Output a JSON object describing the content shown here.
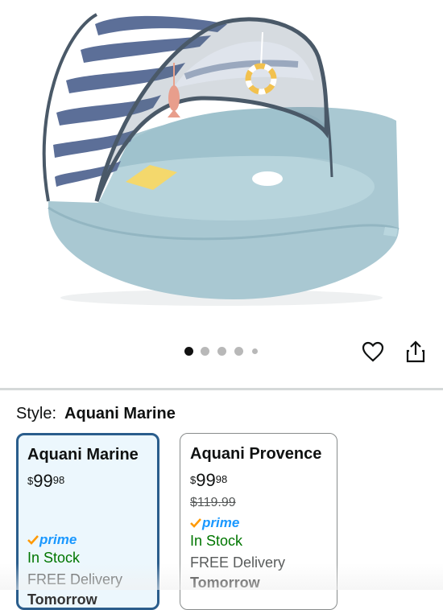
{
  "gallery": {
    "image_alt": "Pop-up baby beach tent with striped canopy",
    "dots_count": 5,
    "active_dot": 0,
    "wishlist_icon": "heart-icon",
    "share_icon": "share-icon"
  },
  "style_selector": {
    "label": "Style:",
    "selected_value": "Aquani Marine"
  },
  "options": [
    {
      "name": "Aquani Marine",
      "price_symbol": "$",
      "price_whole": "99",
      "price_fraction": "98",
      "list_price": "",
      "prime_label": "prime",
      "stock": "In Stock",
      "delivery": "FREE Delivery",
      "delivery_day": "Tomorrow",
      "selected": true
    },
    {
      "name": "Aquani Provence",
      "price_symbol": "$",
      "price_whole": "99",
      "price_fraction": "98",
      "list_price": "$119.99",
      "prime_label": "prime",
      "stock": "In Stock",
      "delivery": "FREE Delivery",
      "delivery_day": "Tomorrow",
      "selected": false
    }
  ],
  "colors": {
    "selected_border": "#2a5d8c",
    "selected_bg": "#ecf7fd",
    "prime_blue": "#1a98ff",
    "prime_check": "#ff9900",
    "in_stock_green": "#007600"
  }
}
